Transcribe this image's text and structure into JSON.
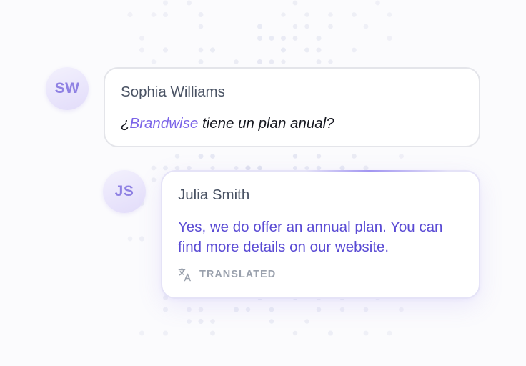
{
  "conversation": {
    "messages": [
      {
        "initials": "SW",
        "sender": "Sophia Williams",
        "text_prefix": "¿",
        "text_brand": "Brandwise",
        "text_suffix": " tiene un plan anual?"
      },
      {
        "initials": "JS",
        "sender": "Julia Smith",
        "text": "Yes, we do offer an annual plan. You can find more details on our website.",
        "status_icon": "translate-icon",
        "status_label": "TRANSLATED"
      }
    ]
  },
  "colors": {
    "accent": "#7c65e8",
    "translated_text": "#5a4bd4",
    "avatar_text": "#8f81e3",
    "muted_label": "#9aa1ad"
  }
}
